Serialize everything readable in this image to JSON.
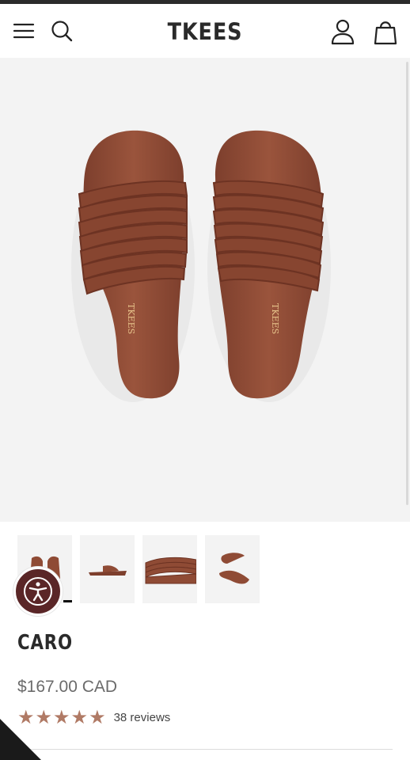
{
  "header": {
    "logo": "TKEES",
    "icons": [
      "menu-icon",
      "search-icon",
      "account-icon",
      "bag-icon"
    ]
  },
  "gallery": {
    "main_image": "caro-sandal-pair-top-view",
    "thumbnails": [
      "caro-sandal-pair-top-view",
      "caro-sandal-side-view",
      "caro-sandal-strap-closeup",
      "caro-sandal-angled-pair"
    ],
    "active_index": 0
  },
  "product": {
    "name": "CARO",
    "price": "$167.00 CAD",
    "rating_stars": 5,
    "reviews": "38 reviews",
    "color": "#8f4b35"
  },
  "accessibility": {
    "icon": "accessibility-icon",
    "color": "#5a2627"
  }
}
